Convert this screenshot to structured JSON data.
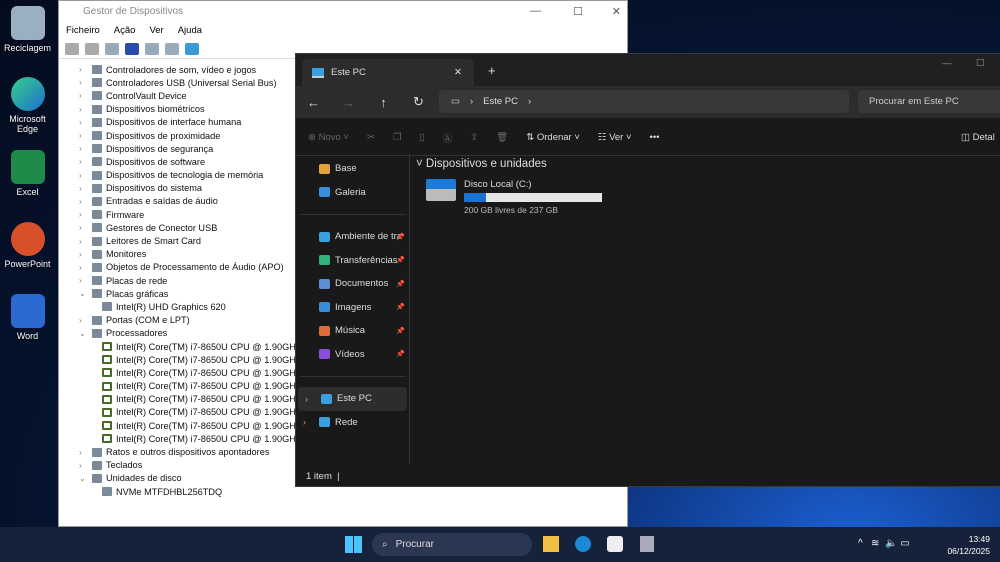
{
  "desktop": {
    "icons": [
      "Reciclagem",
      "Microsoft Edge",
      "Excel",
      "PowerPoint",
      "Word"
    ]
  },
  "device_manager": {
    "title": "Gestor de Dispositivos",
    "menu": [
      "Ficheiro",
      "Ação",
      "Ver",
      "Ajuda"
    ],
    "tree": [
      {
        "label": "Controladores de som, vídeo e jogos",
        "level": 0,
        "exp": ">"
      },
      {
        "label": "Controladores USB (Universal Serial Bus)",
        "level": 0,
        "exp": ">"
      },
      {
        "label": "ControlVault Device",
        "level": 0,
        "exp": ">"
      },
      {
        "label": "Dispositivos biométricos",
        "level": 0,
        "exp": ">"
      },
      {
        "label": "Dispositivos de interface humana",
        "level": 0,
        "exp": ">"
      },
      {
        "label": "Dispositivos de proximidade",
        "level": 0,
        "exp": ">"
      },
      {
        "label": "Dispositivos de segurança",
        "level": 0,
        "exp": ">"
      },
      {
        "label": "Dispositivos de software",
        "level": 0,
        "exp": ">"
      },
      {
        "label": "Dispositivos de tecnologia de memória",
        "level": 0,
        "exp": ">"
      },
      {
        "label": "Dispositivos do sistema",
        "level": 0,
        "exp": ">"
      },
      {
        "label": "Entradas e saídas de áudio",
        "level": 0,
        "exp": ">"
      },
      {
        "label": "Firmware",
        "level": 0,
        "exp": ">"
      },
      {
        "label": "Gestores de Conector USB",
        "level": 0,
        "exp": ">"
      },
      {
        "label": "Leitores de Smart Card",
        "level": 0,
        "exp": ">"
      },
      {
        "label": "Monitores",
        "level": 0,
        "exp": ">"
      },
      {
        "label": "Objetos de Processamento de Áudio (APO)",
        "level": 0,
        "exp": ">"
      },
      {
        "label": "Placas de rede",
        "level": 0,
        "exp": ">"
      },
      {
        "label": "Placas gráficas",
        "level": 0,
        "exp": "v"
      },
      {
        "label": "Intel(R) UHD Graphics 620",
        "level": 1
      },
      {
        "label": "Portas (COM e LPT)",
        "level": 0,
        "exp": ">"
      },
      {
        "label": "Processadores",
        "level": 0,
        "exp": "v"
      },
      {
        "label": "Intel(R) Core(TM) i7-8650U CPU @ 1.90GHz",
        "level": 1,
        "cpu": true
      },
      {
        "label": "Intel(R) Core(TM) i7-8650U CPU @ 1.90GHz",
        "level": 1,
        "cpu": true
      },
      {
        "label": "Intel(R) Core(TM) i7-8650U CPU @ 1.90GHz",
        "level": 1,
        "cpu": true
      },
      {
        "label": "Intel(R) Core(TM) i7-8650U CPU @ 1.90GHz",
        "level": 1,
        "cpu": true
      },
      {
        "label": "Intel(R) Core(TM) i7-8650U CPU @ 1.90GHz",
        "level": 1,
        "cpu": true
      },
      {
        "label": "Intel(R) Core(TM) i7-8650U CPU @ 1.90GHz",
        "level": 1,
        "cpu": true
      },
      {
        "label": "Intel(R) Core(TM) i7-8650U CPU @ 1.90GHz",
        "level": 1,
        "cpu": true
      },
      {
        "label": "Intel(R) Core(TM) i7-8650U CPU @ 1.90GHz",
        "level": 1,
        "cpu": true
      },
      {
        "label": "Ratos e outros dispositivos apontadores",
        "level": 0,
        "exp": ">"
      },
      {
        "label": "Teclados",
        "level": 0,
        "exp": ">"
      },
      {
        "label": "Unidades de disco",
        "level": 0,
        "exp": "v"
      },
      {
        "label": "NVMe MTFDHBL256TDQ",
        "level": 1
      }
    ]
  },
  "explorer": {
    "tab": "Este PC",
    "path": "Este PC",
    "search_placeholder": "Procurar em Este PC",
    "cmd": {
      "new": "Novo",
      "sort": "Ordenar",
      "view": "Ver",
      "more": "•••",
      "details": "Detal"
    },
    "sidebar": [
      {
        "label": "Base",
        "color": "#e8a23a"
      },
      {
        "label": "Galeria",
        "color": "#3b8ee0"
      }
    ],
    "pinned": [
      {
        "label": "Ambiente de tra",
        "color": "#3aa0e0"
      },
      {
        "label": "Transferências",
        "color": "#2fb37a"
      },
      {
        "label": "Documentos",
        "color": "#5a8fd8"
      },
      {
        "label": "Imagens",
        "color": "#3a8ed8"
      },
      {
        "label": "Música",
        "color": "#e06a3a"
      },
      {
        "label": "Vídeos",
        "color": "#8a4fd8"
      }
    ],
    "tree": [
      {
        "label": "Este PC",
        "color": "#3aa0e0"
      },
      {
        "label": "Rede",
        "color": "#3aa0e0"
      }
    ],
    "section": "Dispositivos e unidades",
    "drive": {
      "name": "Disco Local (C:)",
      "free": "200 GB livres de 237 GB",
      "used_fraction": 0.156
    },
    "status": "1 item"
  },
  "taskbar": {
    "search": "Procurar",
    "time": "13:49",
    "date": "06/12/2025"
  }
}
